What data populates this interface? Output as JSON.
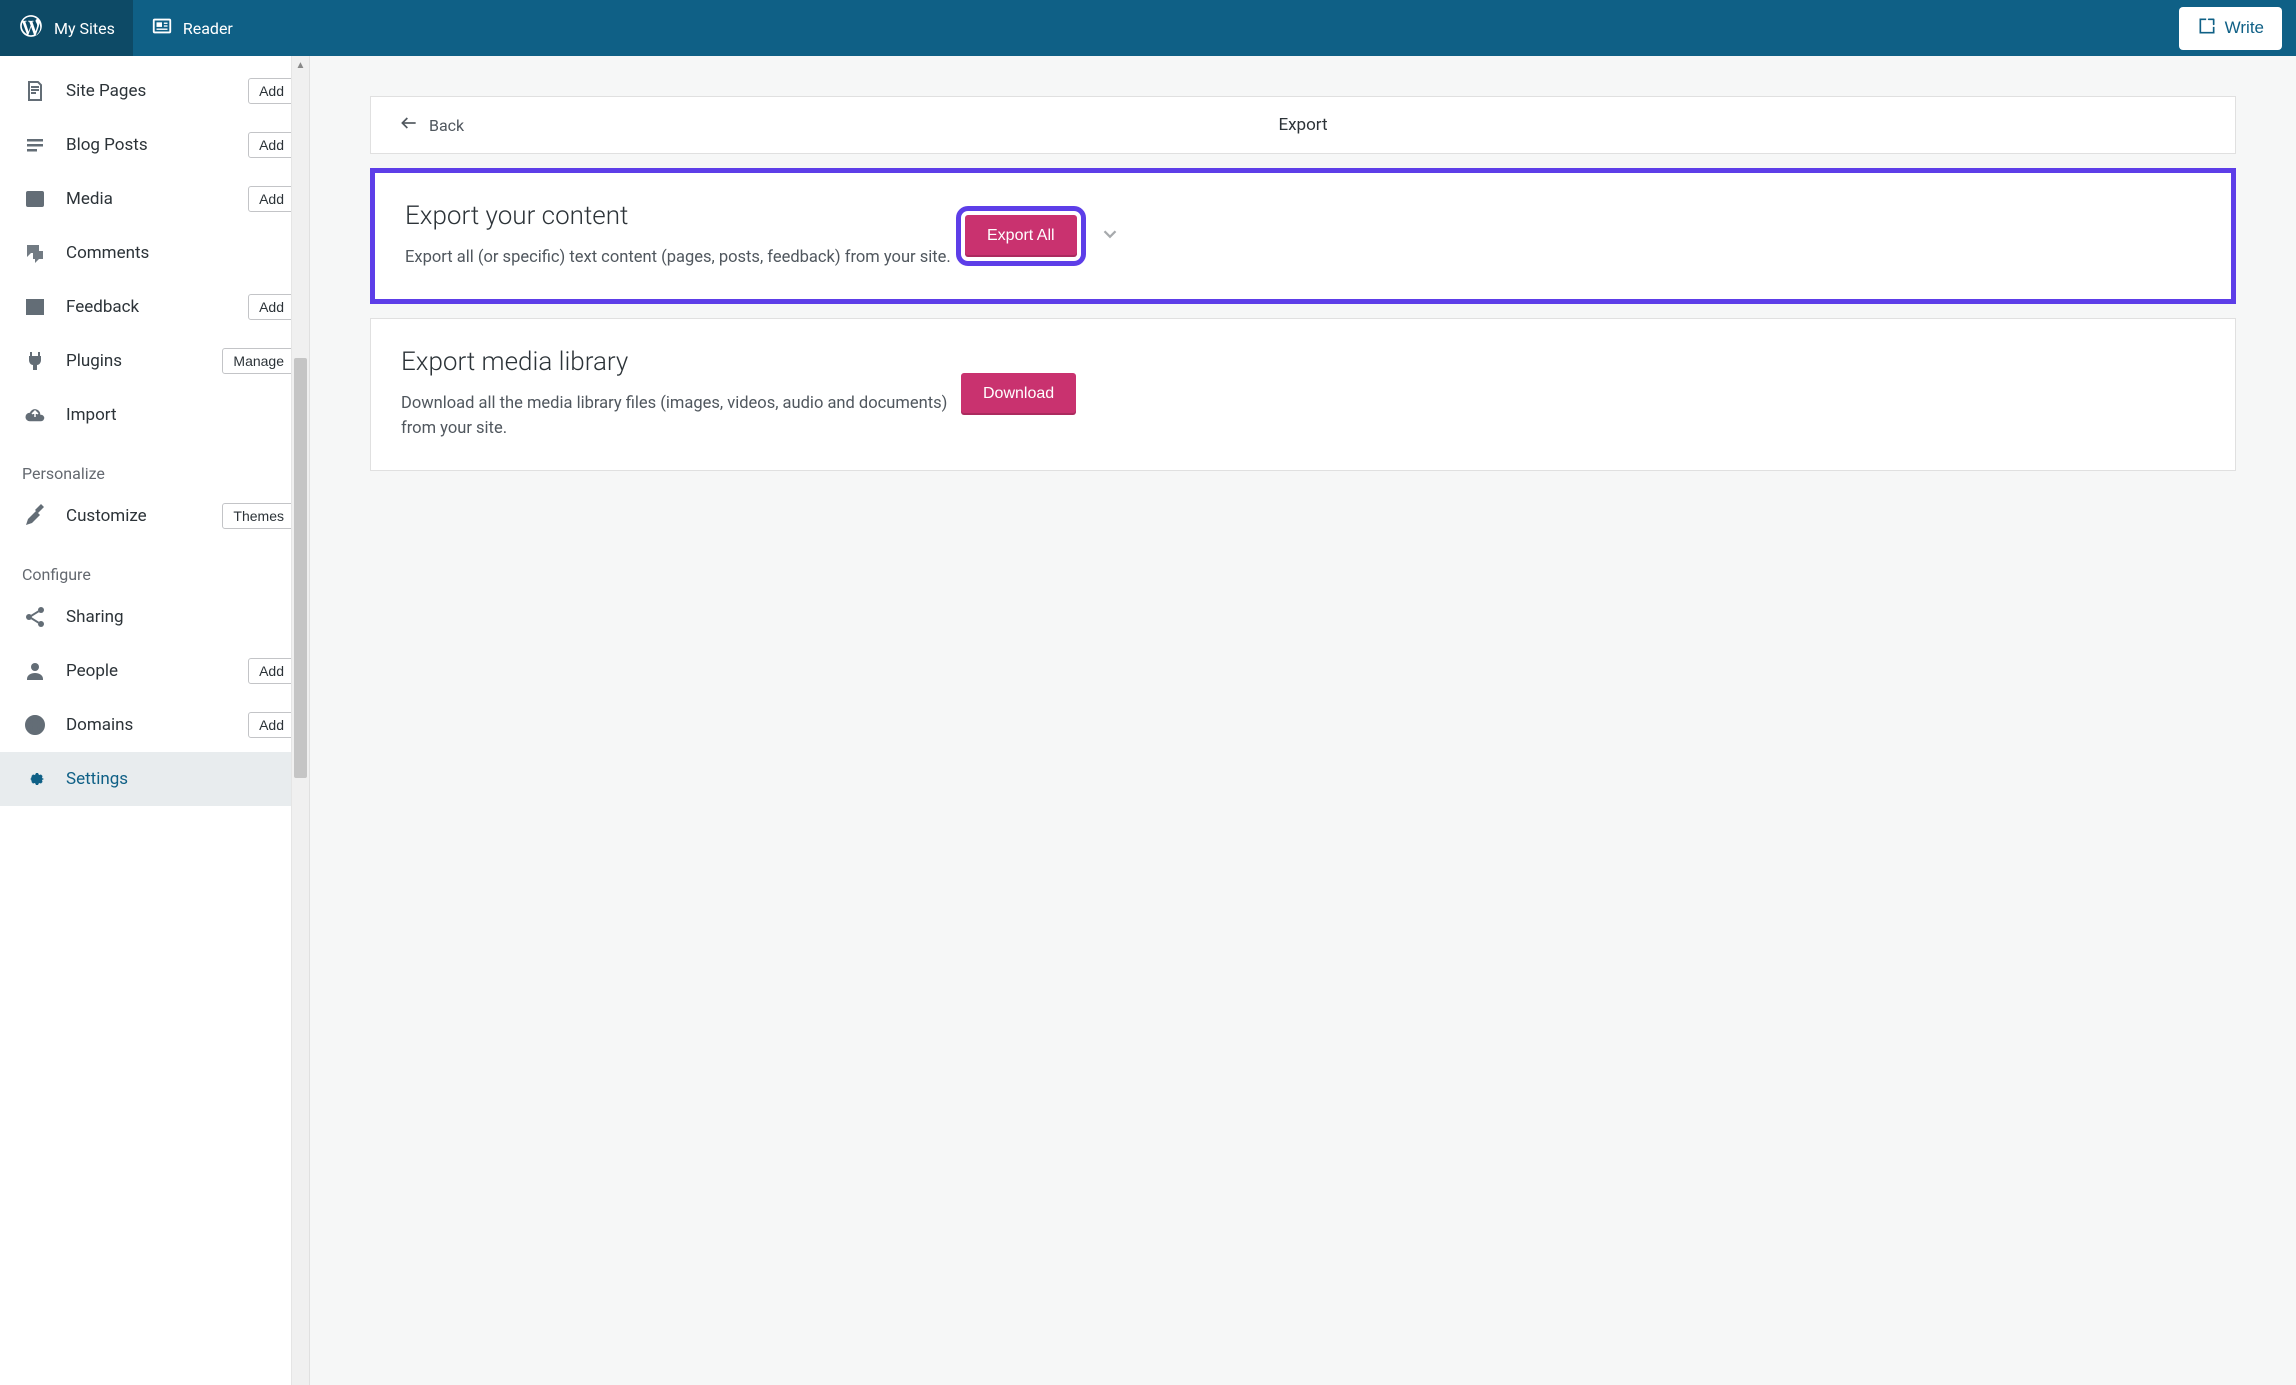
{
  "topbar": {
    "mysites": "My Sites",
    "reader": "Reader",
    "write": "Write"
  },
  "sidebar": {
    "items": [
      {
        "label": "Site Pages",
        "action": "Add",
        "icon": "page"
      },
      {
        "label": "Blog Posts",
        "action": "Add",
        "icon": "posts"
      },
      {
        "label": "Media",
        "action": "Add",
        "icon": "media"
      },
      {
        "label": "Comments",
        "action": "",
        "icon": "comments"
      },
      {
        "label": "Feedback",
        "action": "Add",
        "icon": "feedback"
      },
      {
        "label": "Plugins",
        "action": "Manage",
        "icon": "plugins"
      },
      {
        "label": "Import",
        "action": "",
        "icon": "import"
      }
    ],
    "section1": "Personalize",
    "personalize": [
      {
        "label": "Customize",
        "action": "Themes",
        "icon": "customize"
      }
    ],
    "section2": "Configure",
    "configure": [
      {
        "label": "Sharing",
        "action": "",
        "icon": "sharing"
      },
      {
        "label": "People",
        "action": "Add",
        "icon": "people"
      },
      {
        "label": "Domains",
        "action": "Add",
        "icon": "domains"
      },
      {
        "label": "Settings",
        "action": "",
        "icon": "settings",
        "active": true
      }
    ]
  },
  "header": {
    "back": "Back",
    "title": "Export"
  },
  "cards": {
    "export": {
      "title": "Export your content",
      "desc": "Export all (or specific) text content (pages, posts, feedback) from your site.",
      "button": "Export All"
    },
    "media": {
      "title": "Export media library",
      "desc": "Download all the media library files (images, videos, audio and documents) from your site.",
      "button": "Download"
    }
  }
}
